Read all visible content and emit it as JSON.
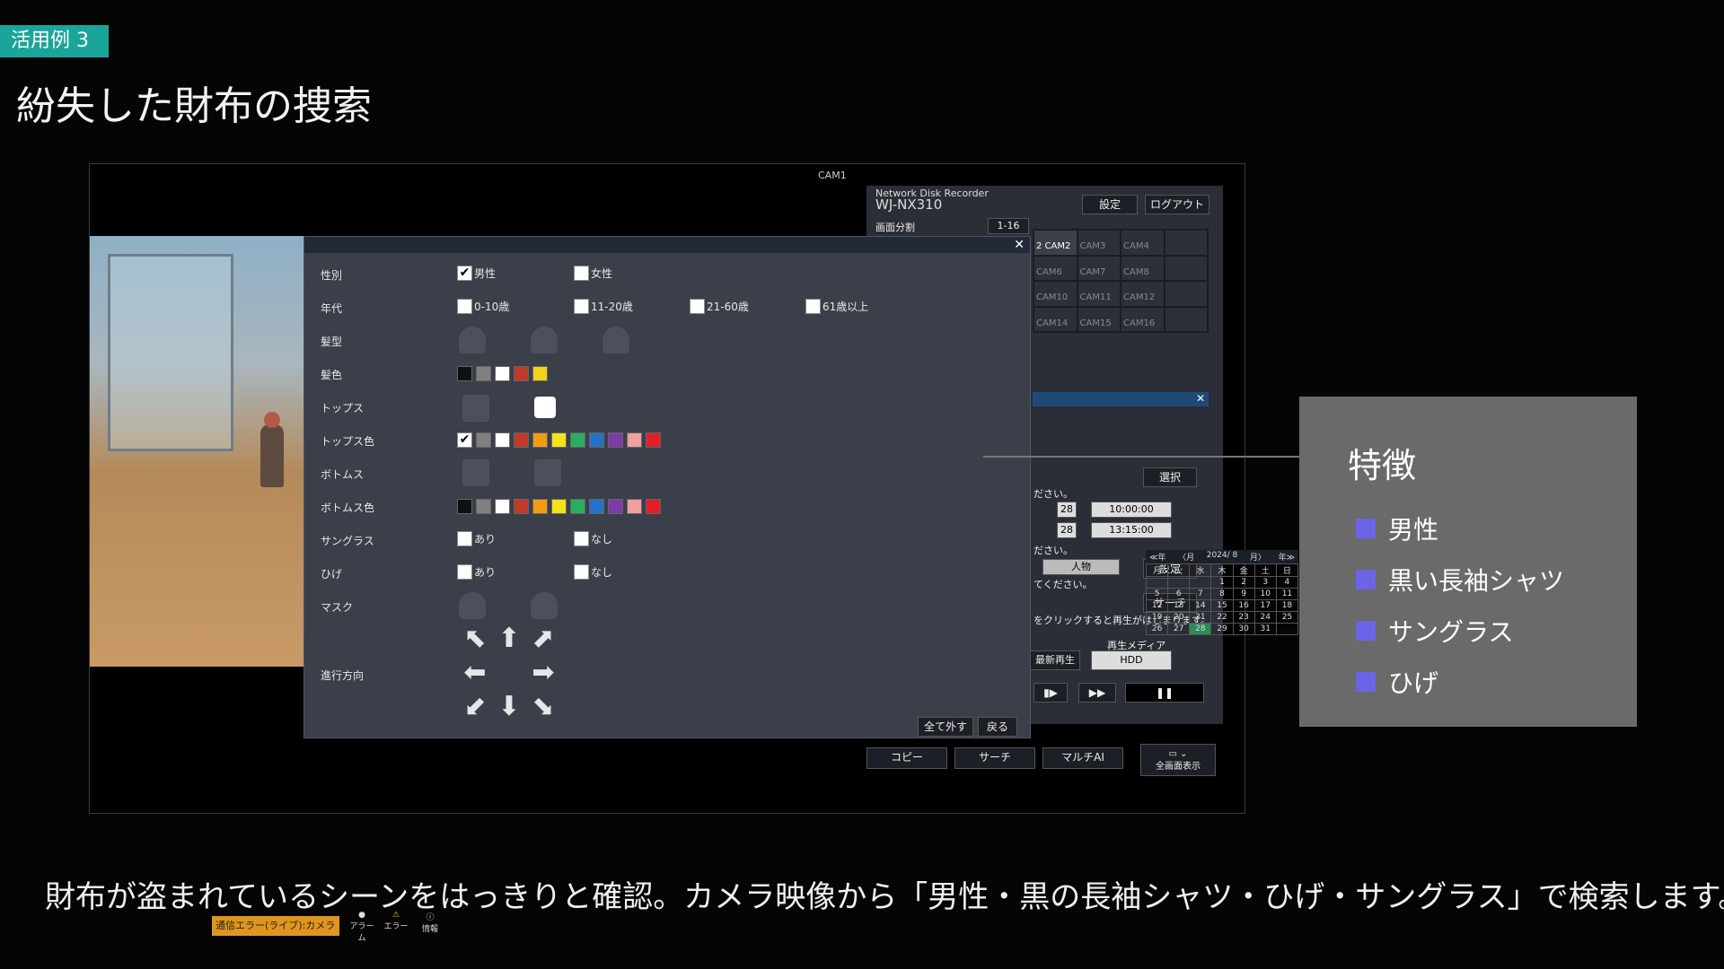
{
  "header": {
    "tag": "活用例 3",
    "title": "紛失した財布の捜索"
  },
  "screen": {
    "cam_label": "CAM1",
    "recorder": {
      "brand": "Network Disk Recorder",
      "model": "WJ-NX310",
      "settings": "設定",
      "logout": "ログアウト",
      "split_label": "画面分割",
      "split_value": "1-16"
    },
    "cams": [
      "2 CAM2",
      "CAM3",
      "CAM4",
      "",
      "CAM6",
      "CAM7",
      "CAM8",
      "",
      "CAM10",
      "CAM11",
      "CAM12",
      "",
      "CAM14",
      "CAM15",
      "CAM16",
      ""
    ],
    "calendar": {
      "nav": [
        "≪年",
        "〈月",
        "2024/ 8",
        "月〉",
        "年≫"
      ],
      "days": [
        "月",
        "火",
        "水",
        "木",
        "金",
        "土",
        "日"
      ],
      "weeks": [
        [
          "",
          "",
          "",
          "1",
          "2",
          "3",
          "4"
        ],
        [
          "5",
          "6",
          "7",
          "8",
          "9",
          "10",
          "11"
        ],
        [
          "12",
          "13",
          "14",
          "15",
          "16",
          "17",
          "18"
        ],
        [
          "19",
          "20",
          "21",
          "22",
          "23",
          "24",
          "25"
        ],
        [
          "26",
          "27",
          "28",
          "29",
          "30",
          "31",
          ""
        ]
      ]
    },
    "search_panel": {
      "select": "選択",
      "hint1": "ださい。",
      "date1": "28",
      "time1": "10:00:00",
      "date2": "28",
      "time2": "13:15:00",
      "hint2": "ださい。",
      "category": "人物",
      "set": "設定",
      "hint3": "てください。",
      "search": "サーチ",
      "hint4": "をクリックすると再生がはじまります。"
    },
    "playback": {
      "media_label": "再生メディア",
      "latest": "最新再生",
      "media": "HDD"
    },
    "bottom_buttons": {
      "copy": "コピー",
      "search": "サーチ",
      "multi": "マルチAI",
      "fullscreen": "全画面表示"
    },
    "filter": {
      "gender": {
        "label": "性別",
        "male": "男性",
        "female": "女性"
      },
      "age": {
        "label": "年代",
        "a": "0-10歳",
        "b": "11-20歳",
        "c": "21-60歳",
        "d": "61歳以上"
      },
      "hair": {
        "label": "髪型"
      },
      "hair_color": {
        "label": "髪色",
        "colors": [
          "#111111",
          "#808080",
          "#ffffff",
          "#c0392b",
          "#f1d21c"
        ]
      },
      "tops": {
        "label": "トップス"
      },
      "tops_color": {
        "label": "トップス色",
        "colors": [
          "#808080",
          "#ffffff",
          "#c0392b",
          "#f39c12",
          "#f1e21c",
          "#27ae60",
          "#2471c7",
          "#7d3aa8",
          "#f0a0a0",
          "#e21f26"
        ]
      },
      "bottoms": {
        "label": "ボトムス"
      },
      "bottoms_color": {
        "label": "ボトムス色",
        "colors": [
          "#111111",
          "#808080",
          "#ffffff",
          "#c0392b",
          "#f39c12",
          "#f1e21c",
          "#27ae60",
          "#2471c7",
          "#7d3aa8",
          "#f0a0a0",
          "#e21f26"
        ]
      },
      "sunglasses": {
        "label": "サングラス",
        "yes": "あり",
        "no": "なし"
      },
      "beard": {
        "label": "ひげ",
        "yes": "あり",
        "no": "なし"
      },
      "mask": {
        "label": "マスク"
      },
      "direction": {
        "label": "進行方向"
      },
      "clear_all": "全て外す",
      "back": "戻る"
    },
    "status": {
      "error": "通信エラー(ライブ):カメラ",
      "alarm": "アラーム",
      "error_label": "エラー",
      "info": "情報"
    }
  },
  "features": {
    "title": "特徴",
    "items": [
      "男性",
      "黒い長袖シャツ",
      "サングラス",
      "ひげ"
    ],
    "accent": "#6b64e6"
  },
  "caption": "財布が盗まれているシーンをはっきりと確認。カメラ映像から「男性・黒の長袖シャツ・ひげ・サングラス」で検索します。"
}
